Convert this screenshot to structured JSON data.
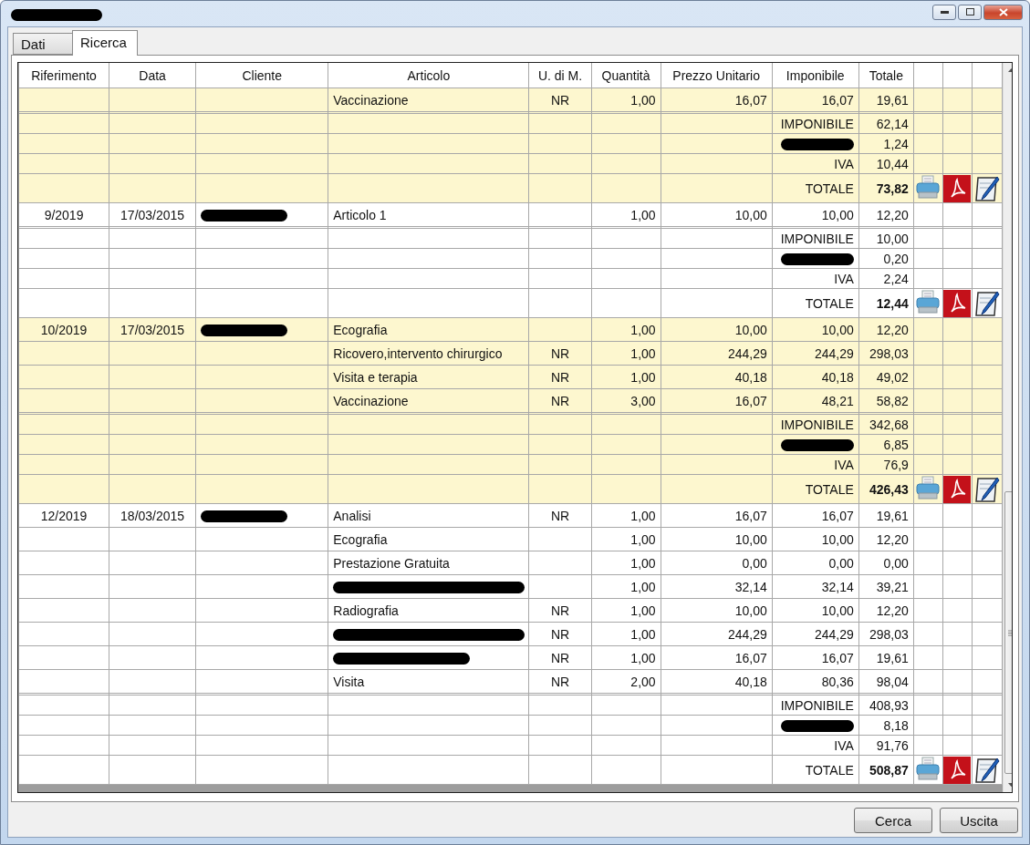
{
  "window": {
    "title": {
      "redacted": true
    }
  },
  "tabs": [
    {
      "label": "Dati",
      "selected": false
    },
    {
      "label": "Ricerca",
      "selected": true
    }
  ],
  "table": {
    "columns": [
      "Riferimento",
      "Data",
      "Cliente",
      "Articolo",
      "U. di M.",
      "Quantità",
      "Prezzo Unitario",
      "Imponibile",
      "Totale"
    ],
    "groups": [
      {
        "shaded": true,
        "lines": [
          {
            "articolo": "Vaccinazione",
            "udm": "NR",
            "quantita": "1,00",
            "prezzo": "16,07",
            "imponibile": "16,07",
            "totale": "19,61"
          }
        ],
        "summary": [
          {
            "label": "IMPONIBILE",
            "value": "62,14",
            "total": false
          },
          {
            "label": {
              "redacted": true
            },
            "value": "1,24",
            "total": false
          },
          {
            "label": "IVA",
            "value": "10,44",
            "total": false
          },
          {
            "label": "TOTALE",
            "value": "73,82",
            "total": true
          }
        ]
      },
      {
        "shaded": false,
        "riferimento": "9/2019",
        "data": "17/03/2015",
        "cliente": {
          "redacted": true
        },
        "lines": [
          {
            "articolo": "Articolo 1",
            "quantita": "1,00",
            "prezzo": "10,00",
            "imponibile": "10,00",
            "totale": "12,20"
          }
        ],
        "summary": [
          {
            "label": "IMPONIBILE",
            "value": "10,00",
            "total": false
          },
          {
            "label": {
              "redacted": true
            },
            "value": "0,20",
            "total": false
          },
          {
            "label": "IVA",
            "value": "2,24",
            "total": false
          },
          {
            "label": "TOTALE",
            "value": "12,44",
            "total": true
          }
        ]
      },
      {
        "shaded": true,
        "riferimento": "10/2019",
        "data": "17/03/2015",
        "cliente": {
          "redacted": true
        },
        "lines": [
          {
            "articolo": "Ecografia",
            "quantita": "1,00",
            "prezzo": "10,00",
            "imponibile": "10,00",
            "totale": "12,20"
          },
          {
            "articolo": "Ricovero,intervento chirurgico",
            "udm": "NR",
            "quantita": "1,00",
            "prezzo": "244,29",
            "imponibile": "244,29",
            "totale": "298,03"
          },
          {
            "articolo": "Visita e terapia",
            "udm": "NR",
            "quantita": "1,00",
            "prezzo": "40,18",
            "imponibile": "40,18",
            "totale": "49,02"
          },
          {
            "articolo": "Vaccinazione",
            "udm": "NR",
            "quantita": "3,00",
            "prezzo": "16,07",
            "imponibile": "48,21",
            "totale": "58,82"
          }
        ],
        "summary": [
          {
            "label": "IMPONIBILE",
            "value": "342,68",
            "total": false
          },
          {
            "label": {
              "redacted": true
            },
            "value": "6,85",
            "total": false
          },
          {
            "label": "IVA",
            "value": "76,9",
            "total": false
          },
          {
            "label": "TOTALE",
            "value": "426,43",
            "total": true
          }
        ]
      },
      {
        "shaded": false,
        "riferimento": "12/2019",
        "data": "18/03/2015",
        "cliente": {
          "redacted": true
        },
        "lines": [
          {
            "articolo": "Analisi",
            "udm": "NR",
            "quantita": "1,00",
            "prezzo": "16,07",
            "imponibile": "16,07",
            "totale": "19,61"
          },
          {
            "articolo": "Ecografia",
            "quantita": "1,00",
            "prezzo": "10,00",
            "imponibile": "10,00",
            "totale": "12,20"
          },
          {
            "articolo": "Prestazione Gratuita",
            "quantita": "1,00",
            "prezzo": "0,00",
            "imponibile": "0,00",
            "totale": "0,00"
          },
          {
            "articolo": {
              "redacted": true
            },
            "quantita": "1,00",
            "prezzo": "32,14",
            "imponibile": "32,14",
            "totale": "39,21"
          },
          {
            "articolo": "Radiografia",
            "udm": "NR",
            "quantita": "1,00",
            "prezzo": "10,00",
            "imponibile": "10,00",
            "totale": "12,20"
          },
          {
            "articolo": {
              "redacted": true
            },
            "udm": "NR",
            "quantita": "1,00",
            "prezzo": "244,29",
            "imponibile": "244,29",
            "totale": "298,03"
          },
          {
            "articolo": {
              "redacted": true
            },
            "udm": "NR",
            "quantita": "1,00",
            "prezzo": "16,07",
            "imponibile": "16,07",
            "totale": "19,61"
          },
          {
            "articolo": "Visita",
            "udm": "NR",
            "quantita": "2,00",
            "prezzo": "40,18",
            "imponibile": "80,36",
            "totale": "98,04"
          }
        ],
        "summary": [
          {
            "label": "IMPONIBILE",
            "value": "408,93",
            "total": false
          },
          {
            "label": {
              "redacted": true
            },
            "value": "8,18",
            "total": false
          },
          {
            "label": "IVA",
            "value": "91,76",
            "total": false
          },
          {
            "label": "TOTALE",
            "value": "508,87",
            "total": true
          }
        ]
      }
    ]
  },
  "buttons": [
    "Cerca",
    "Uscita"
  ]
}
